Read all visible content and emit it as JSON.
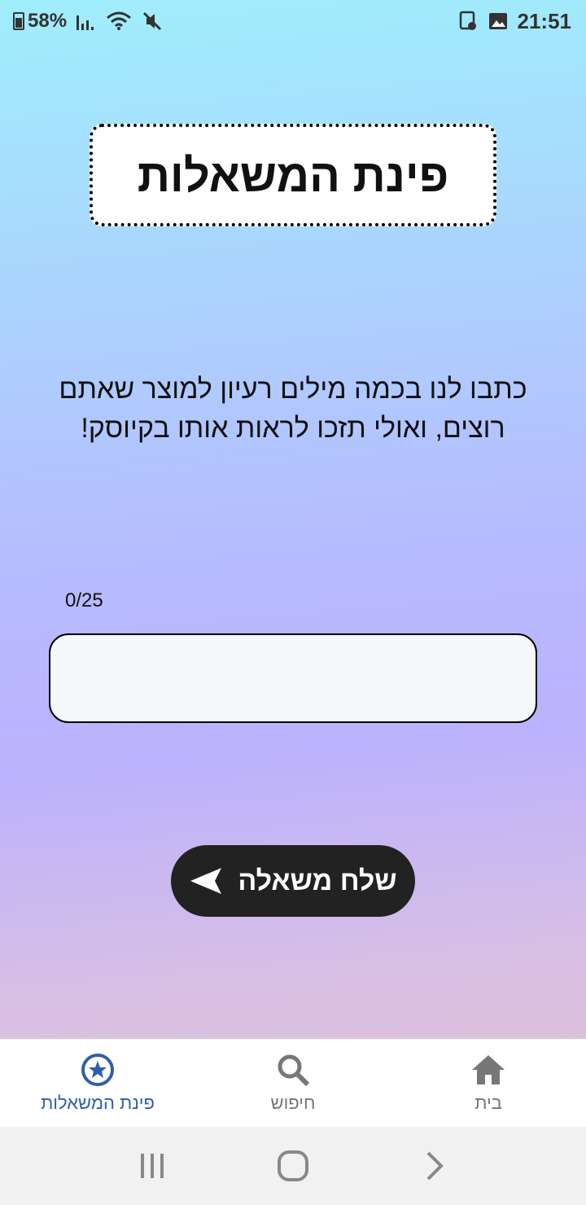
{
  "status_bar": {
    "battery": "58%",
    "time": "21:51",
    "icons": [
      "battery-icon",
      "signal-icon",
      "wifi-icon",
      "mute-icon",
      "alarm-clock-icon",
      "image-icon"
    ]
  },
  "header": {
    "title": "פינת המשאלות"
  },
  "prompt": {
    "line1": "כתבו לנו בכמה מילים רעיון למוצר שאתם",
    "line2": "רוצים, ואולי תזכו לראות אותו בקיוסק!"
  },
  "input": {
    "counter": "0/25",
    "value": "",
    "placeholder": ""
  },
  "send_button": {
    "label": "שלח משאלה",
    "icon": "send-icon"
  },
  "bottom_nav": {
    "items": [
      {
        "label": "בית",
        "icon": "home-icon",
        "active": false
      },
      {
        "label": "חיפוש",
        "icon": "search-icon",
        "active": false
      },
      {
        "label": "פינת המשאלות",
        "icon": "star-circle-icon",
        "active": true
      }
    ]
  },
  "colors": {
    "accent": "#2f5fa8",
    "button_bg": "#222222",
    "input_bg": "#f6f7f9",
    "gradient_top": "#9feefc",
    "gradient_mid": "#bcb2fd",
    "gradient_bottom": "#e2c4cc"
  },
  "system_nav": {
    "icons": [
      "recent-apps-icon",
      "home-circle-icon",
      "back-icon"
    ]
  }
}
